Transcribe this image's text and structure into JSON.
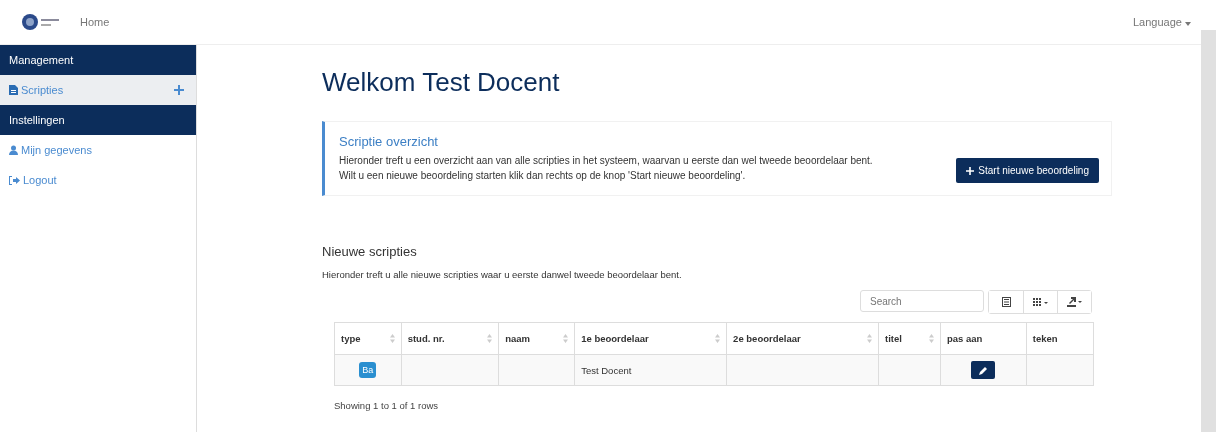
{
  "navbar": {
    "home": "Home",
    "language": "Language"
  },
  "sidebar": {
    "items": [
      {
        "kind": "header",
        "label": "Management"
      },
      {
        "kind": "documents",
        "label": "Scripties",
        "selected": true,
        "add": true
      },
      {
        "kind": "header",
        "label": "Instellingen"
      },
      {
        "kind": "profile",
        "label": "Mijn gegevens",
        "selected": false,
        "add": false
      },
      {
        "kind": "logout",
        "label": "Logout",
        "selected": false,
        "add": false
      }
    ]
  },
  "page": {
    "title": "Welkom Test Docent"
  },
  "overview": {
    "title": "Scriptie overzicht",
    "lines": [
      "Hieronder treft u een overzicht aan van alle scripties in het systeem, waarvan u eerste dan wel tweede beoordelaar bent.",
      "Wilt u een nieuwe beoordeling starten klik dan rechts op de knop 'Start nieuwe beoordeling'."
    ],
    "button": "Start nieuwe beoordeling"
  },
  "table_section": {
    "title": "Nieuwe scripties",
    "description": "Hieronder treft u alle nieuwe scripties waar u eerste danwel tweede beoordelaar bent.",
    "search": {
      "placeholder": "Search"
    },
    "columns": [
      {
        "label": "type",
        "sortable": true
      },
      {
        "label": "stud. nr.",
        "sortable": true
      },
      {
        "label": "naam",
        "sortable": true
      },
      {
        "label": "1e beoordelaar",
        "sortable": true
      },
      {
        "label": "2e beoordelaar",
        "sortable": true
      },
      {
        "label": "titel",
        "sortable": true
      },
      {
        "label": "pas aan",
        "sortable": false
      },
      {
        "label": "teken",
        "sortable": false
      }
    ],
    "rows": [
      {
        "type": "Ba",
        "beoordelaar_1": "Test Docent",
        "edit": true
      }
    ],
    "footer": "Showing 1 to 1 of 1 rows"
  }
}
